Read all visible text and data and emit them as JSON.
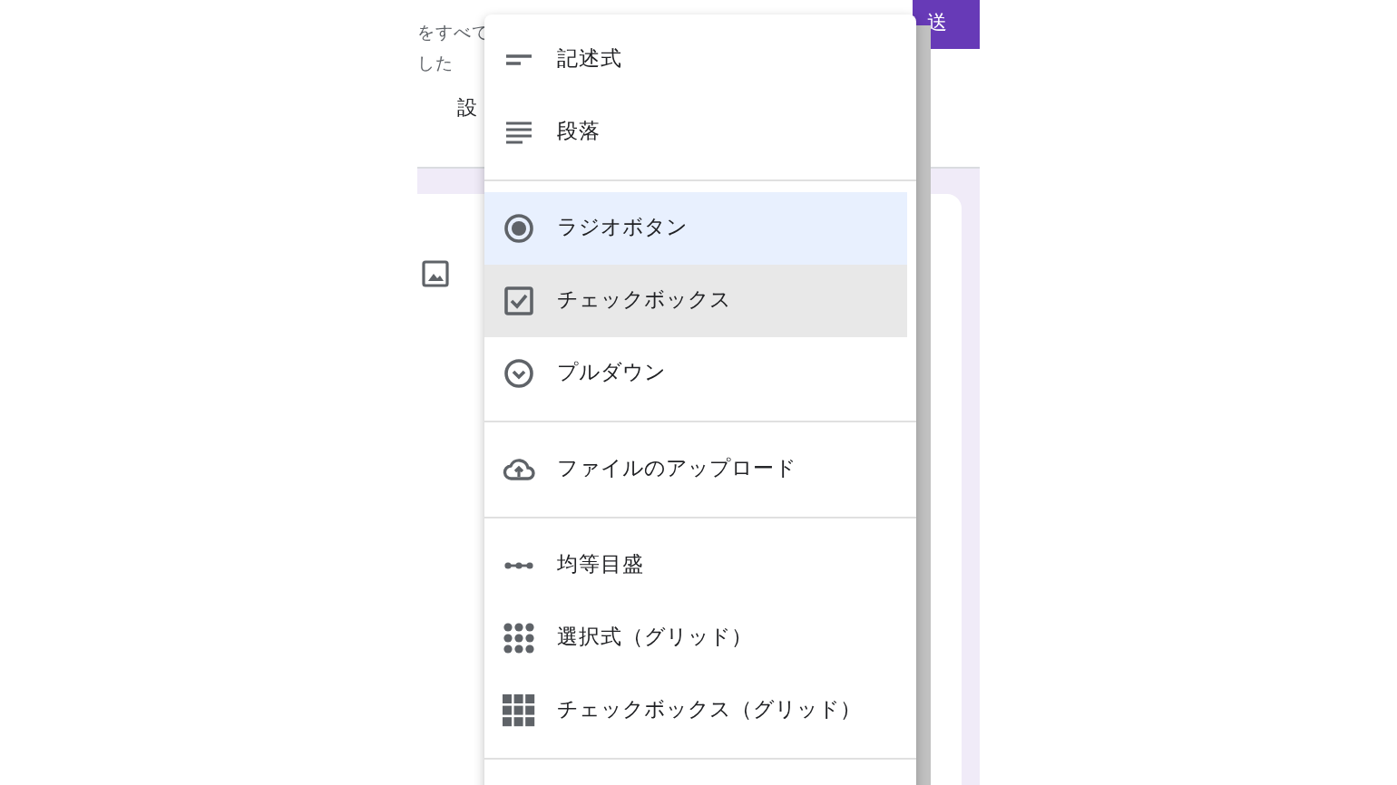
{
  "header": {
    "description_lines": [
      "をすべて",
      "した"
    ],
    "tab": "設",
    "send_button": "送"
  },
  "menu": {
    "sections": [
      {
        "items": [
          {
            "label": "記述式",
            "selected": false,
            "hovered": false
          },
          {
            "label": "段落",
            "selected": false,
            "hovered": false
          }
        ]
      },
      {
        "items": [
          {
            "label": "ラジオボタン",
            "selected": true,
            "hovered": false
          },
          {
            "label": "チェックボックス",
            "selected": false,
            "hovered": true
          },
          {
            "label": "プルダウン",
            "selected": false,
            "hovered": false
          }
        ]
      },
      {
        "items": [
          {
            "label": "ファイルのアップロード",
            "selected": false,
            "hovered": false
          }
        ]
      },
      {
        "items": [
          {
            "label": "均等目盛",
            "selected": false,
            "hovered": false
          },
          {
            "label": "選択式（グリッド）",
            "selected": false,
            "hovered": false
          },
          {
            "label": "チェックボックス（グリッド）",
            "selected": false,
            "hovered": false
          }
        ]
      }
    ]
  }
}
